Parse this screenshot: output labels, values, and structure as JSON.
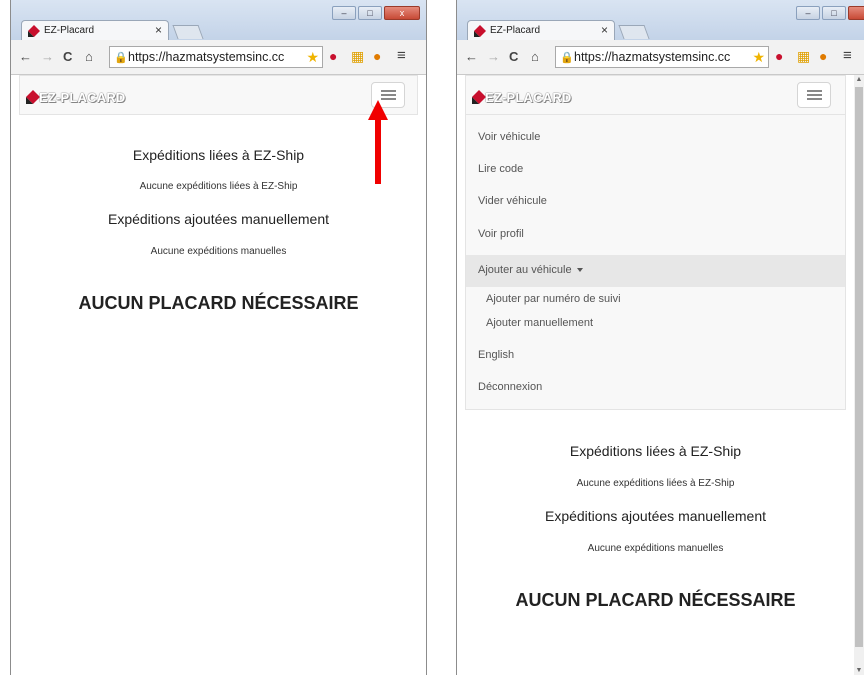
{
  "browser": {
    "tab_title": "EZ-Placard",
    "tab_close": "×",
    "url": "https://hazmatsystemsinc.cc",
    "window_controls": [
      "–",
      "□",
      "x"
    ],
    "icons": [
      "back-icon",
      "forward-icon",
      "reload-icon",
      "home-icon",
      "lock-icon",
      "star-icon",
      "extension-icon",
      "menu-icon"
    ]
  },
  "app": {
    "brand": "EZ-PLACARD",
    "accent_color": "#c8102e",
    "menu": {
      "items": [
        "Voir véhicule",
        "Lire code",
        "Vider véhicule",
        "Voir profil"
      ],
      "dropdown_label": "Ajouter au véhicule",
      "dropdown_items": [
        "Ajouter par numéro de suivi",
        "Ajouter manuellement"
      ],
      "language": "English",
      "logout": "Déconnexion"
    },
    "sections": {
      "ezship_title": "Expéditions liées à EZ-Ship",
      "ezship_empty": "Aucune expéditions liées à EZ-Ship",
      "manual_title": "Expéditions ajoutées manuellement",
      "manual_empty": "Aucune expéditions manuelles"
    },
    "notice": "AUCUN PLACARD NÉCESSAIRE"
  }
}
